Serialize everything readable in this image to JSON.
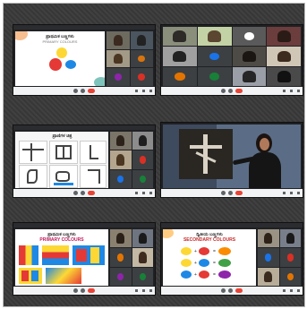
{
  "panels": [
    {
      "slide_title": "ಪ್ರಾಥಮಿಕ ಬಣ್ಣಗಳು",
      "slide_subtitle": "PRIMARY COLOURS",
      "colors": {
        "red": "#e53935",
        "yellow": "#fdd835",
        "blue": "#1e88e5"
      }
    },
    {},
    {
      "slide_title": "ಪ್ರಾಣಿಗಳ ಚಿತ್ರ"
    },
    {},
    {
      "slide_title": "ಪ್ರಾಥಮಿಕ ಬಣ್ಣಗಳು",
      "slide_subtitle": "PRIMARY COLOURS"
    },
    {
      "slide_title": "ದ್ವಿತೀಯ ಬಣ್ಣಗಳು",
      "slide_subtitle": "SECONDARY COLOURS",
      "rows": [
        {
          "left": "#fdd835",
          "right": "#e53935",
          "result": "#fb8c00"
        },
        {
          "left": "#fdd835",
          "right": "#1e88e5",
          "result": "#43a047"
        },
        {
          "left": "#1e88e5",
          "right": "#e53935",
          "result": "#8e24aa"
        }
      ]
    }
  ]
}
